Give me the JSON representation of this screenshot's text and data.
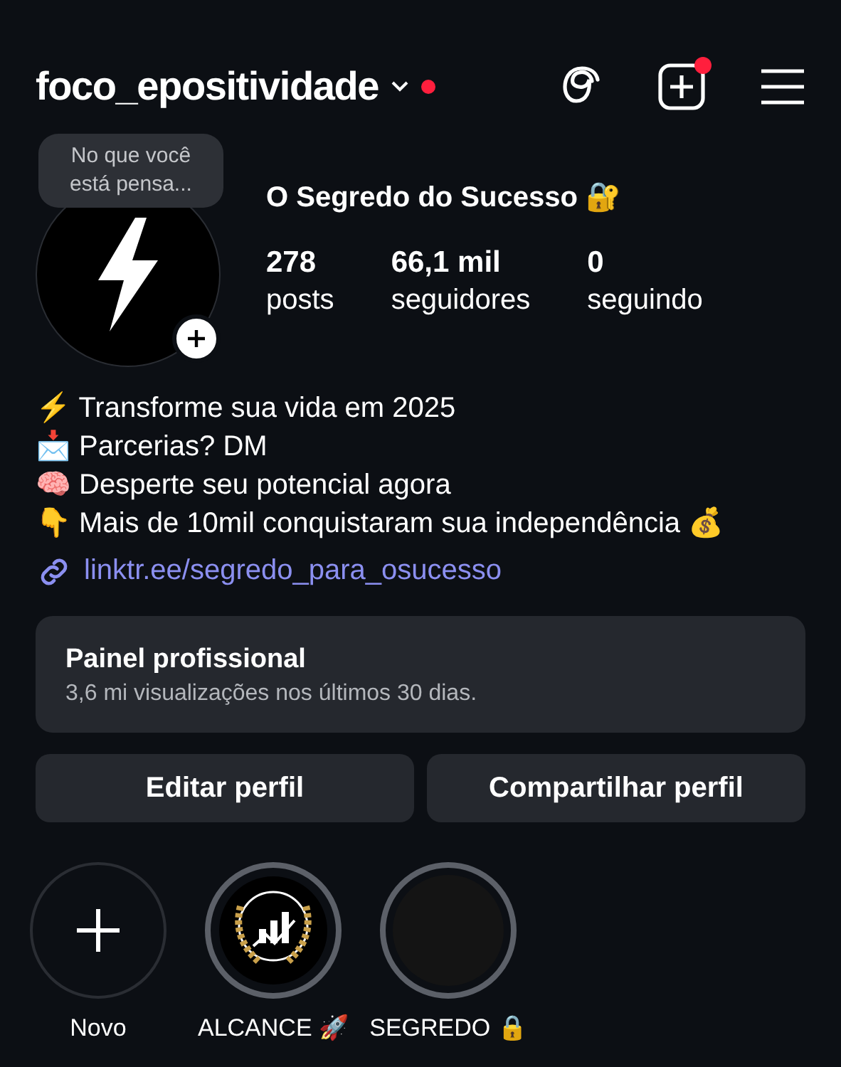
{
  "header": {
    "username": "foco_epositividade",
    "notification_dot": true,
    "new_post_dot": true
  },
  "profile": {
    "note_bubble": "No que você está pensa...",
    "display_name": "O Segredo do Sucesso 🔐",
    "stats": [
      {
        "value": "278",
        "label": "posts"
      },
      {
        "value": "66,1 mil",
        "label": "seguidores"
      },
      {
        "value": "0",
        "label": "seguindo"
      }
    ]
  },
  "bio": [
    "⚡ Transforme sua vida em 2025",
    "📩 Parcerias? DM",
    "🧠 Desperte seu potencial agora",
    "👇 Mais de 10mil conquistaram sua independência 💰"
  ],
  "link": "linktr.ee/segredo_para_osucesso",
  "professional_panel": {
    "title": "Painel profissional",
    "subtitle": "3,6 mi visualizações nos últimos 30 dias."
  },
  "buttons": [
    "Editar perfil",
    "Compartilhar perfil"
  ],
  "highlights": [
    {
      "kind": "new",
      "label": "Novo"
    },
    {
      "kind": "chart",
      "label": "ALCANCE 🚀"
    },
    {
      "kind": "dark",
      "label": "SEGREDO 🔒"
    }
  ]
}
